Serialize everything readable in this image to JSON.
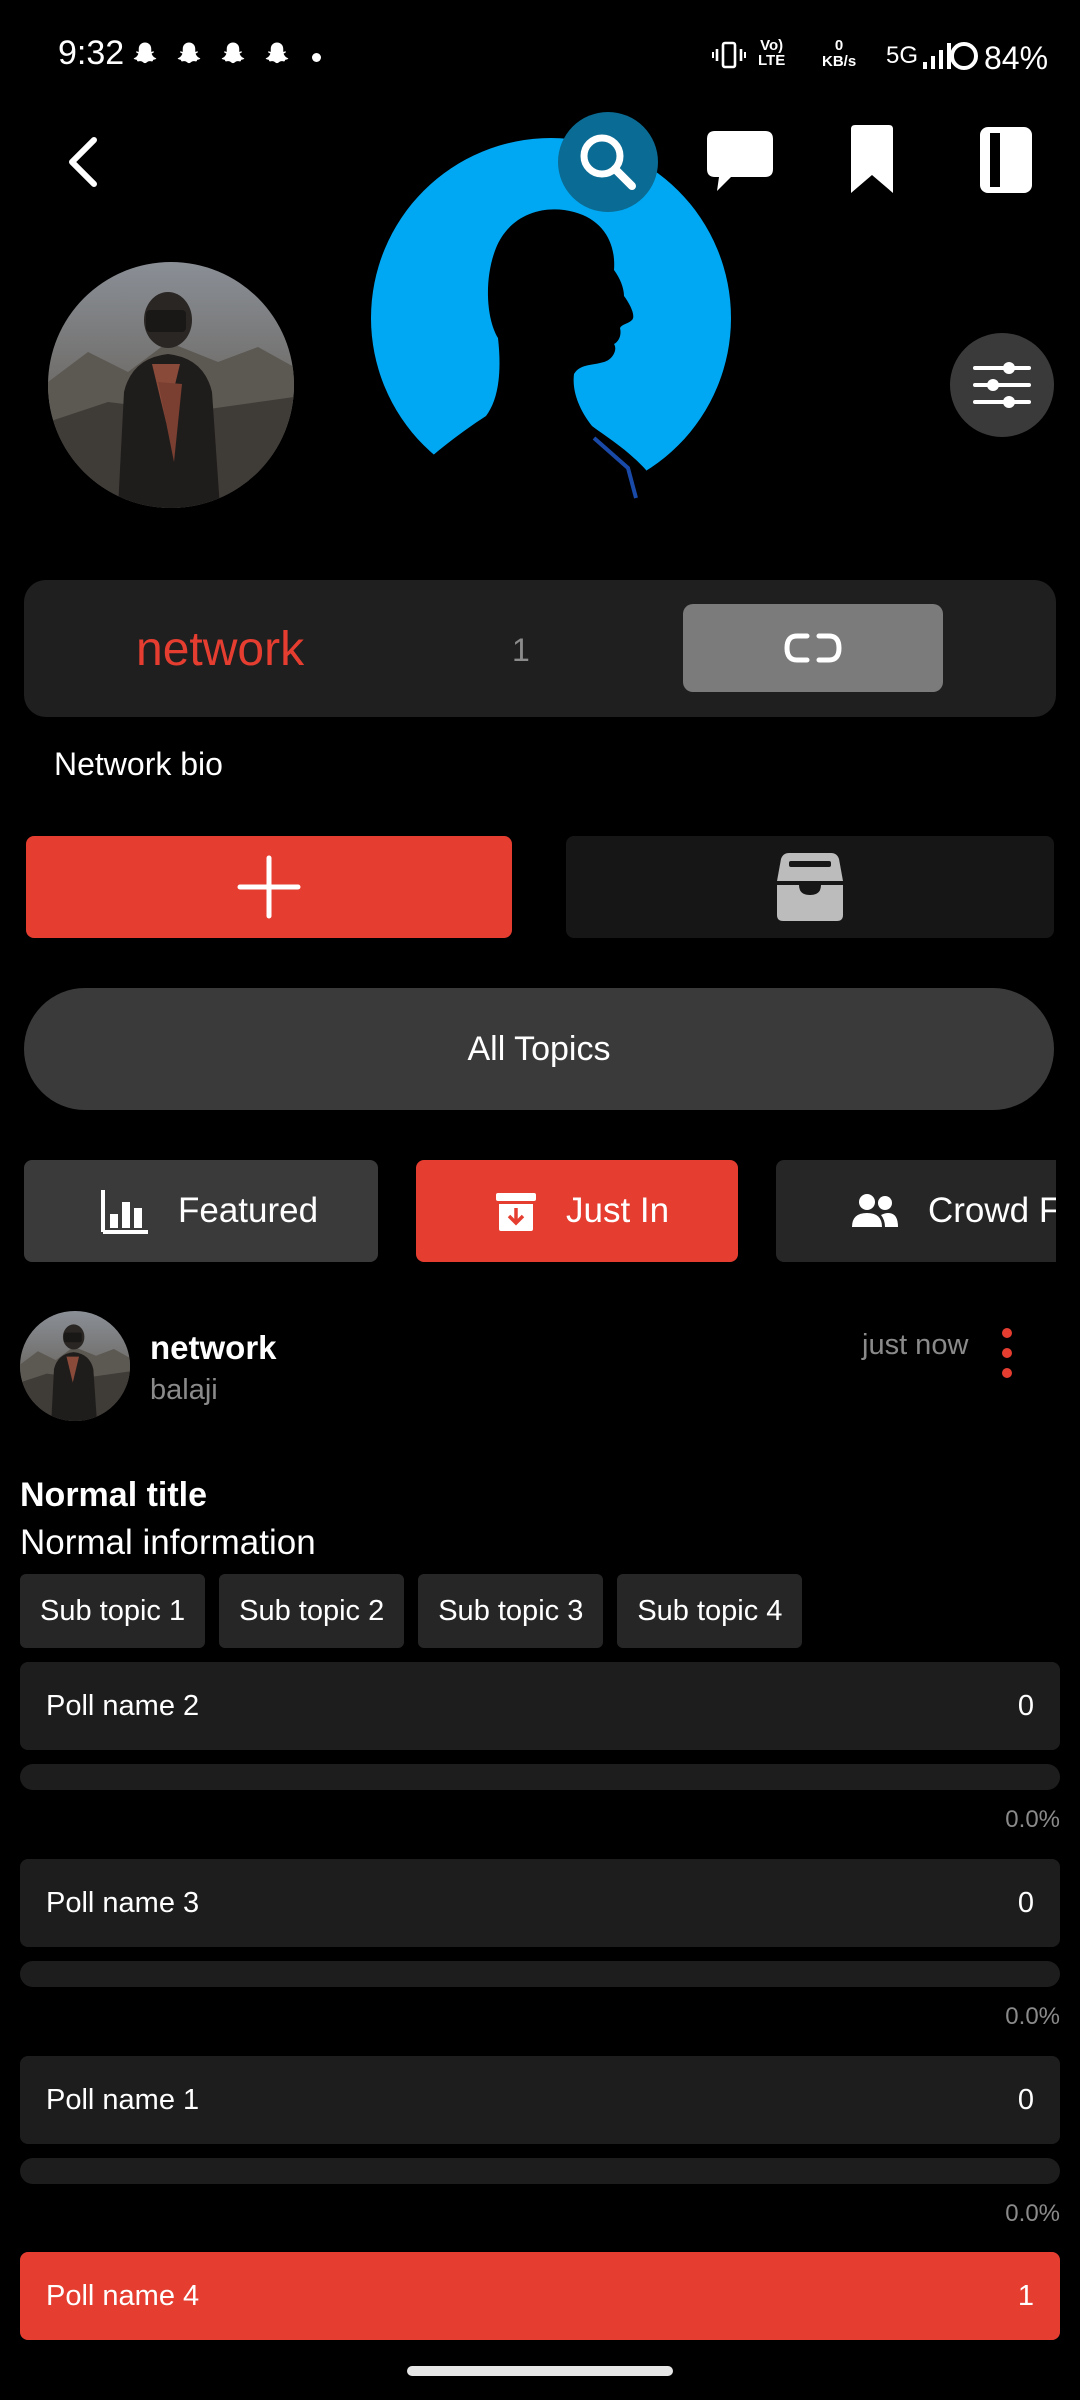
{
  "status_bar": {
    "time": "9:32",
    "network_type_top": "Vo)",
    "network_type_bottom": "LTE",
    "speed_value": "0",
    "speed_unit": "KB/s",
    "signal_label": "5G",
    "battery": "84%"
  },
  "header": {
    "icons": [
      "back-arrow-icon",
      "search-icon",
      "chat-icon",
      "bookmark-icon",
      "sidebar-toggle-icon"
    ]
  },
  "profile": {
    "network_name": "network",
    "member_count": "1",
    "bio": "Network bio"
  },
  "actions": {
    "all_topics_label": "All Topics"
  },
  "tabs": [
    {
      "label": "Featured",
      "icon": "bar-chart-icon",
      "active": false
    },
    {
      "label": "Just In",
      "icon": "archive-down-icon",
      "active": true
    },
    {
      "label": "Crowd Favorites",
      "icon": "people-icon",
      "active": false
    }
  ],
  "post": {
    "author": "network",
    "username": "balaji",
    "time": "just now",
    "title": "Normal title",
    "info": "Normal information",
    "sub_topics": [
      "Sub topic 1",
      "Sub topic 2",
      "Sub topic 3",
      "Sub topic 4"
    ],
    "polls": [
      {
        "name": "Poll name 2",
        "count": "0",
        "percent": "0.0%",
        "fraction": 0
      },
      {
        "name": "Poll name 3",
        "count": "0",
        "percent": "0.0%",
        "fraction": 0
      },
      {
        "name": "Poll name 1",
        "count": "0",
        "percent": "0.0%",
        "fraction": 0
      },
      {
        "name": "Poll name 4",
        "count": "1"
      }
    ]
  },
  "colors": {
    "accent": "#e53e31",
    "card": "#1f1f1f",
    "cover_blue": "#00a8f3"
  }
}
